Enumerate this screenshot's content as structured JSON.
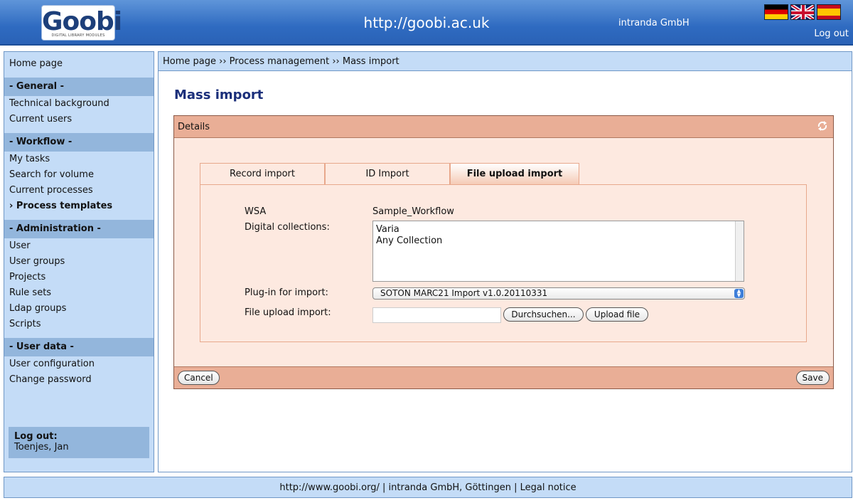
{
  "header": {
    "logo_text": "Goobi",
    "logo_subtext": "DIGITAL LIBRARY MODULES",
    "site_url": "http://goobi.ac.uk",
    "company": "intranda GmbH",
    "logout_label": "Log out",
    "flags": [
      "german-flag-icon",
      "uk-flag-icon",
      "spanish-flag-icon"
    ]
  },
  "sidebar": {
    "home": "Home page",
    "general_head": "- General -",
    "general_items": [
      "Technical background",
      "Current users"
    ],
    "workflow_head": "- Workflow -",
    "workflow_items": [
      "My tasks",
      "Search for volume",
      "Current processes",
      "› Process templates"
    ],
    "admin_head": "- Administration -",
    "admin_items": [
      "User",
      "User groups",
      "Projects",
      "Rule sets",
      "Ldap groups",
      "Scripts"
    ],
    "userdata_head": "- User data -",
    "userdata_items": [
      "User configuration",
      "Change password"
    ],
    "logout_title": "Log out:",
    "logout_user": "Toenjes, Jan"
  },
  "breadcrumb": "Home page ›› Process management ›› Mass import",
  "page_title": "Mass import",
  "details": {
    "header": "Details",
    "tabs": [
      "Record import",
      "ID Import",
      "File upload import"
    ],
    "active_tab": "File upload import",
    "wsa_label": "WSA",
    "wsa_value": "Sample_Workflow",
    "collections_label": "Digital collections:",
    "collections": [
      "Varia",
      "Any Collection"
    ],
    "plugin_label": "Plug-in for import:",
    "plugin_value": "SOTON MARC21 Import v1.0.20110331",
    "file_label": "File upload import:",
    "browse_button": "Durchsuchen...",
    "upload_button": "Upload file",
    "cancel_button": "Cancel",
    "save_button": "Save"
  },
  "footer": "http://www.goobi.org/ | intranda GmbH, Göttingen | Legal notice",
  "colors": {
    "header_blue": "#2f6bc1",
    "sidebar_bg": "#c4dcf7",
    "panel_head": "#e9ae96",
    "panel_bg": "#fde9e0",
    "title_color": "#1b2f7a"
  }
}
